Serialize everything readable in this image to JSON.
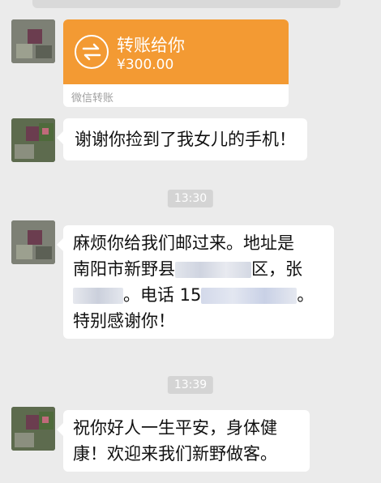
{
  "transfer": {
    "title": "转账给你",
    "amount": "¥300.00",
    "footer": "微信转账",
    "icon": "transfer-arrows-icon",
    "color": "#f39a33"
  },
  "messages": [
    {
      "text": "谢谢你捡到了我女儿的手机！"
    },
    {
      "time": "13:30"
    },
    {
      "line1": "麻烦你给我们邮过来。地址是",
      "line2_prefix": "南阳市新野县",
      "line2_suffix": "区，张",
      "line3_mid": "。电话 15",
      "line3_end": "。",
      "line4": "特别感谢你！"
    },
    {
      "time": "13:39"
    },
    {
      "line1": "祝你好人一生平安，身体健",
      "line2": "康！欢迎来我们新野做客。"
    }
  ]
}
